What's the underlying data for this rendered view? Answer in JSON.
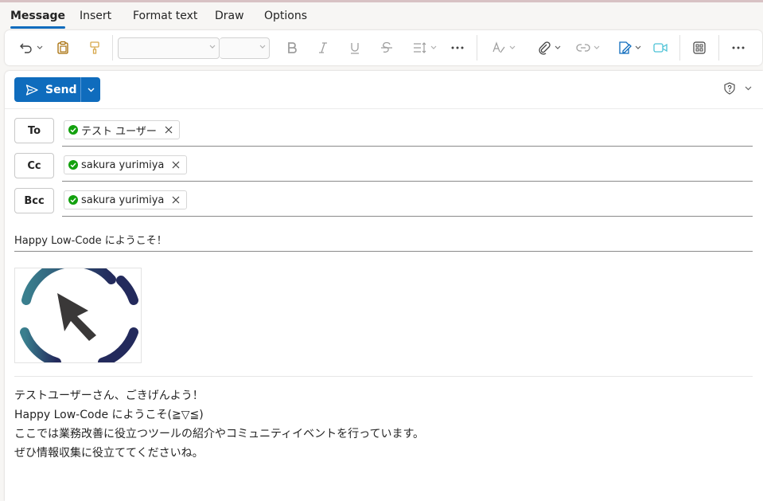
{
  "tabs": [
    "Message",
    "Insert",
    "Format text",
    "Draw",
    "Options"
  ],
  "toolbar": {
    "icons": [
      "undo-icon",
      "paste-icon",
      "format-painter-icon",
      "bold-icon",
      "italic-icon",
      "underline-icon",
      "strikethrough-icon",
      "paragraph-spacing-icon",
      "more-icon",
      "editor-icon",
      "attach-icon",
      "link-icon",
      "signature-icon",
      "meeting-icon",
      "apps-icon",
      "more-options-icon"
    ],
    "font_name": "",
    "font_size": ""
  },
  "send": {
    "label": "Send"
  },
  "recipients": {
    "to": {
      "label": "To",
      "chips": [
        "テスト ユーザー"
      ]
    },
    "cc": {
      "label": "Cc",
      "chips": [
        "sakura yurimiya"
      ]
    },
    "bcc": {
      "label": "Bcc",
      "chips": [
        "sakura yurimiya"
      ]
    }
  },
  "subject": "Happy Low-Code にようこそ！",
  "body": {
    "lines": [
      "テストユーザーさん、ごきげんよう！",
      "Happy Low-Code にようこそ(≧▽≦)",
      "ここでは業務改善に役立つツールの紹介やコミュニティイベントを行っています。",
      "ぜひ情報収集に役立ててくださいね。"
    ]
  },
  "colors": {
    "accent": "#0f6cbd",
    "chip_check": "#13a10e",
    "logo_teal": "#3a7f8e",
    "logo_navy": "#232a5c",
    "cursor": "#3a3838"
  }
}
